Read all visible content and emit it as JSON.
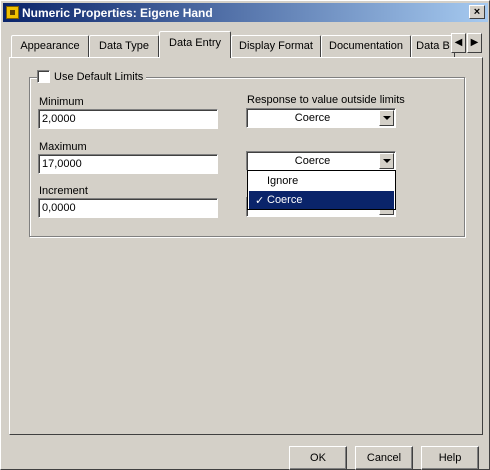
{
  "window": {
    "title": "Numeric Properties: Eigene Hand",
    "close_glyph": "×"
  },
  "tabs": [
    {
      "label": "Appearance",
      "active": false
    },
    {
      "label": "Data Type",
      "active": false
    },
    {
      "label": "Data Entry",
      "active": true
    },
    {
      "label": "Display Format",
      "active": false
    },
    {
      "label": "Documentation",
      "active": false
    },
    {
      "label": "Data B",
      "active": false
    }
  ],
  "tab_scroll": {
    "left_glyph": "◀",
    "right_glyph": "▶"
  },
  "limits": {
    "use_default_label": "Use Default Limits",
    "use_default_checked": false,
    "minimum_label": "Minimum",
    "minimum_value": "2,0000",
    "maximum_label": "Maximum",
    "maximum_value": "17,0000",
    "increment_label": "Increment",
    "increment_value": "0,0000",
    "response_label": "Response to value outside limits",
    "min_response": "Coerce",
    "max_response": "Coerce"
  },
  "dropdown": {
    "options": [
      "Ignore",
      "Coerce"
    ],
    "selected": "Coerce",
    "check_glyph": "✓"
  },
  "buttons": {
    "ok": "OK",
    "cancel": "Cancel",
    "help": "Help"
  },
  "colors": {
    "titlebar": "#0a246a",
    "selection": "#0a246a",
    "face": "#d4d0c8"
  }
}
